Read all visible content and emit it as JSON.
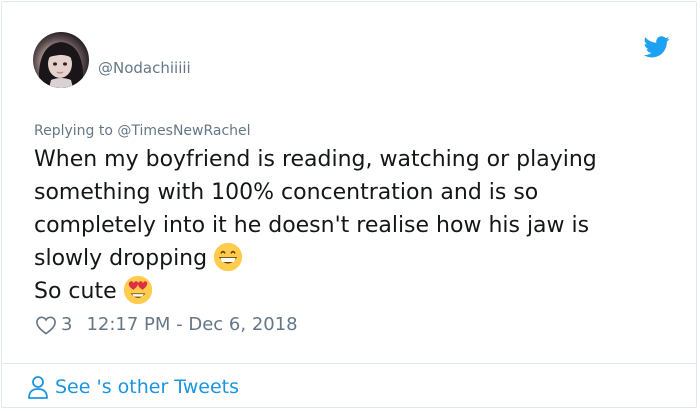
{
  "tweet": {
    "handle": "@Nodachiiiii",
    "reply_prefix": "Replying to",
    "reply_to": "@TimesNewRachel",
    "lines": [
      "When my boyfriend is reading, watching or playing",
      "something with 100% concentration and is so",
      "completely into it he doesn't realise how his jaw is",
      "slowly dropping",
      "So cute"
    ],
    "emoji_1": "grinning-face-emoji",
    "emoji_2": "heart-eyes-emoji",
    "like_count": "3",
    "timestamp": "12:17 PM - Dec 6, 2018"
  },
  "footer": {
    "link_text": "See 's other Tweets"
  },
  "colors": {
    "link": "#1b95e0",
    "twitter_blue": "#1da1f2",
    "muted": "#657786",
    "text": "#14171a"
  },
  "icons": {
    "brand": "twitter-bird-icon",
    "like": "heart-outline-icon",
    "profile": "person-icon"
  }
}
